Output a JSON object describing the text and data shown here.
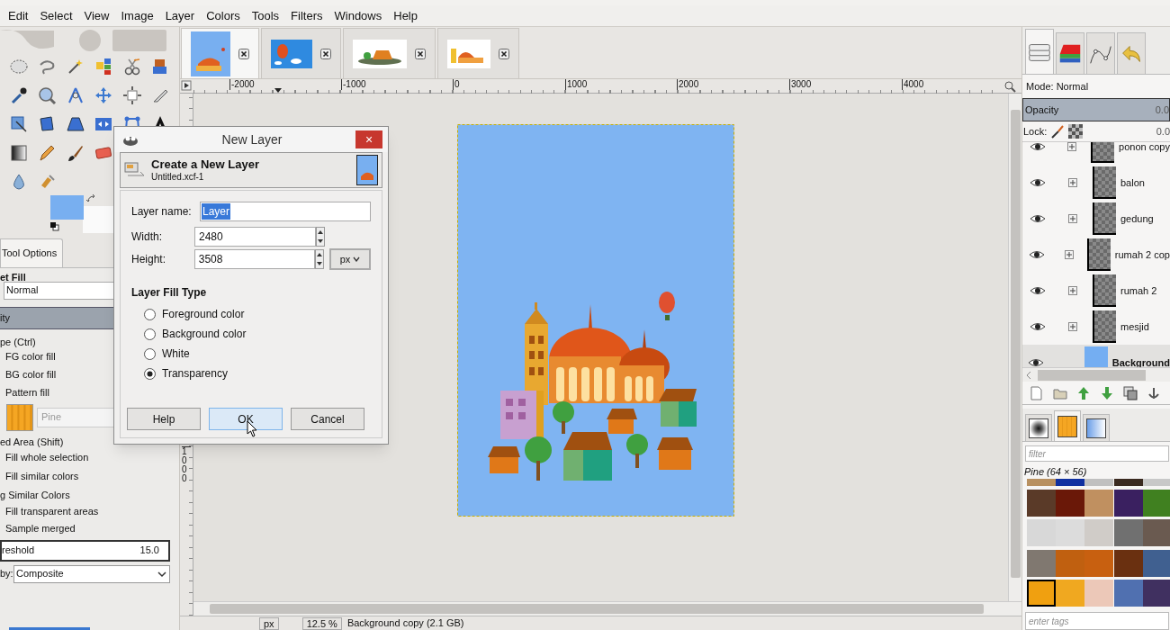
{
  "menu": [
    "Edit",
    "Select",
    "View",
    "Image",
    "Layer",
    "Colors",
    "Tools",
    "Filters",
    "Windows",
    "Help"
  ],
  "image_tabs": [
    {
      "kind": "city",
      "selected": true
    },
    {
      "kind": "balloon",
      "selected": false
    },
    {
      "kind": "house",
      "selected": false
    },
    {
      "kind": "mosque",
      "selected": false
    }
  ],
  "ruler": {
    "h_labels": [
      "-2000",
      "-1000",
      "0",
      "1000",
      "2000",
      "3000",
      "4000"
    ],
    "v_labels": [
      "1000"
    ]
  },
  "tool_options": {
    "tab": "Tool Options",
    "title": "et Fill",
    "mode": "Normal",
    "opacity": {
      "label": "ity",
      "level": 1
    },
    "fill_type_label": "pe  (Ctrl)",
    "fill_types": [
      "FG color fill",
      "BG color fill",
      "Pattern fill"
    ],
    "pattern": "Pine",
    "area_label": "ed Area  (Shift)",
    "areas": [
      "Fill whole selection",
      "Fill similar colors"
    ],
    "similar_label": "g Similar Colors",
    "similar_options": [
      "Fill transparent areas",
      "Sample merged"
    ],
    "threshold_label": "reshold",
    "threshold": "15.0",
    "by_label": "by:",
    "by_value": "Composite"
  },
  "dialog": {
    "title": "New Layer",
    "close": "×",
    "heading": "Create a New Layer",
    "subheading": "Untitled.xcf-1",
    "name_label": "Layer name:",
    "name_value": "Layer",
    "width_label": "Width:",
    "width_value": "2480",
    "height_label": "Height:",
    "height_value": "3508",
    "unit": "px",
    "fill_heading": "Layer Fill Type",
    "fill_types": [
      {
        "label": "Foreground color",
        "selected": false
      },
      {
        "label": "Background color",
        "selected": false
      },
      {
        "label": "White",
        "selected": false
      },
      {
        "label": "Transparency",
        "selected": true
      }
    ],
    "buttons": [
      {
        "label": "Help",
        "hovered": false
      },
      {
        "label": "OK",
        "hovered": true
      },
      {
        "label": "Cancel",
        "hovered": false
      }
    ]
  },
  "layers_panel": {
    "dock_tabs": [
      {
        "kind": "layers",
        "selected": true
      },
      {
        "kind": "channels",
        "selected": false
      },
      {
        "kind": "paths",
        "selected": false
      },
      {
        "kind": "history",
        "selected": false
      }
    ],
    "mode": "Mode: Normal",
    "opacity": {
      "label": "Opacity",
      "value": "0.0",
      "level": 1
    },
    "lock_label": "Lock:",
    "lock_value": "0.0",
    "layers": [
      {
        "name": "ponon copy",
        "visible": true,
        "kind": "transparent",
        "selected": false
      },
      {
        "name": "balon",
        "visible": true,
        "kind": "transparent",
        "selected": false
      },
      {
        "name": "gedung",
        "visible": true,
        "kind": "transparent",
        "selected": false
      },
      {
        "name": "rumah 2 cop",
        "visible": true,
        "kind": "transparent",
        "selected": false
      },
      {
        "name": "rumah 2",
        "visible": true,
        "kind": "transparent",
        "selected": false
      },
      {
        "name": "mesjid",
        "visible": true,
        "kind": "transparent",
        "selected": false
      },
      {
        "name": "Background",
        "visible": true,
        "kind": "solid",
        "selected": true
      }
    ]
  },
  "patterns_panel": {
    "dock_tabs": [
      {
        "kind": "brushes",
        "selected": false
      },
      {
        "kind": "patterns",
        "selected": true
      },
      {
        "kind": "gradients",
        "selected": false
      }
    ],
    "filter_placeholder": "filter",
    "pattern_name": "Pine (64 × 56)",
    "tags_placeholder": "enter tags",
    "patterns": [
      {
        "selected": false
      },
      {
        "selected": false
      },
      {
        "selected": false
      },
      {
        "selected": false
      },
      {
        "selected": false
      },
      {
        "selected": false
      },
      {
        "selected": false
      },
      {
        "selected": false
      },
      {
        "selected": false
      },
      {
        "selected": false
      },
      {
        "selected": false
      },
      {
        "selected": false
      },
      {
        "selected": false
      },
      {
        "selected": false
      },
      {
        "selected": false
      },
      {
        "selected": false
      },
      {
        "selected": false
      },
      {
        "selected": false
      },
      {
        "selected": false
      },
      {
        "selected": false
      },
      {
        "selected": true
      },
      {
        "selected": false
      },
      {
        "selected": false
      },
      {
        "selected": false
      },
      {
        "selected": false
      }
    ]
  },
  "status": {
    "unit": "px",
    "zoom": "12.5 %",
    "message": "Background copy (2.1 GB)"
  }
}
